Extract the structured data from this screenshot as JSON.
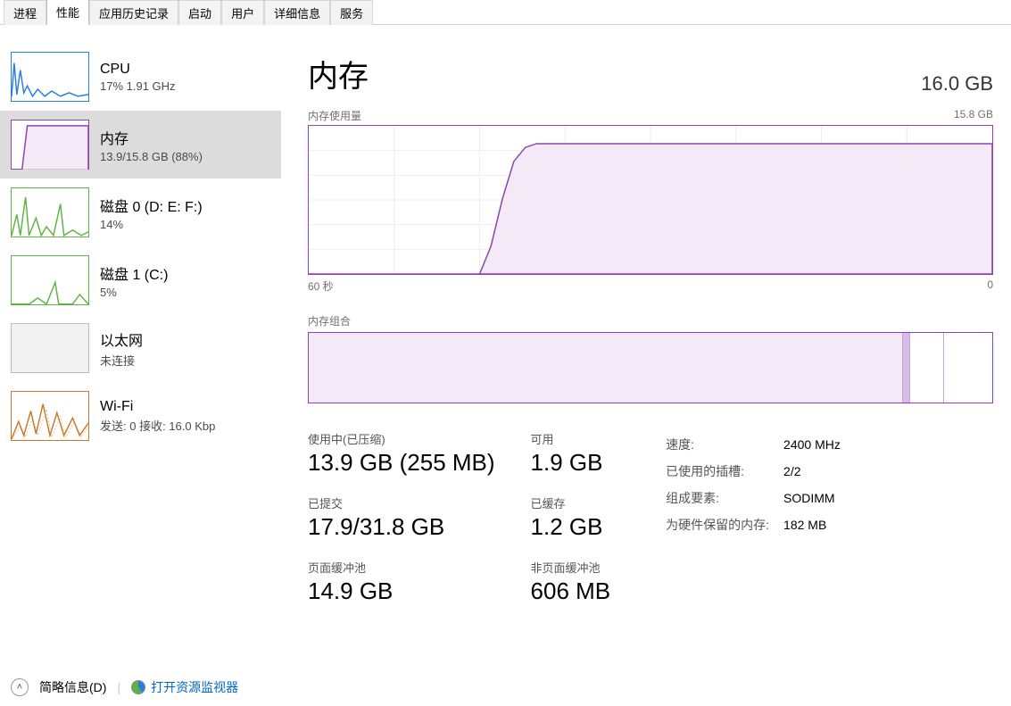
{
  "tabs": [
    "进程",
    "性能",
    "应用历史记录",
    "启动",
    "用户",
    "详细信息",
    "服务"
  ],
  "active_tab_index": 1,
  "sidebar": [
    {
      "title": "CPU",
      "sub": "17% 1.91 GHz",
      "color": "#2a7de1",
      "kind": "cpu"
    },
    {
      "title": "内存",
      "sub": "13.9/15.8 GB (88%)",
      "color": "#8e44ad",
      "kind": "memory",
      "selected": true
    },
    {
      "title": "磁盘 0 (D: E: F:)",
      "sub": "14%",
      "color": "#5fb343",
      "kind": "disk"
    },
    {
      "title": "磁盘 1 (C:)",
      "sub": "5%",
      "color": "#5fb343",
      "kind": "disk"
    },
    {
      "title": "以太网",
      "sub": "未连接",
      "color": "#bcbcbc",
      "kind": "net-off"
    },
    {
      "title": "Wi-Fi",
      "sub": "发送: 0 接收: 16.0 Kbp",
      "color": "#c77a2e",
      "kind": "wifi"
    }
  ],
  "header": {
    "title": "内存",
    "total": "16.0 GB"
  },
  "chart": {
    "label_left": "内存使用量",
    "label_right": "15.8 GB",
    "x_left": "60 秒",
    "x_right": "0"
  },
  "chart_data": {
    "type": "area",
    "title": "内存使用量",
    "xlabel": "60 秒 → 0",
    "ylabel": "GB",
    "ylim": [
      0,
      15.8
    ],
    "x_seconds_ago": [
      60,
      55,
      50,
      45,
      44,
      43,
      42,
      41,
      40,
      35,
      30,
      25,
      20,
      15,
      10,
      5,
      0
    ],
    "values_gb": [
      0,
      0,
      0,
      0,
      3,
      8,
      12,
      13.5,
      13.9,
      13.9,
      13.9,
      13.9,
      13.9,
      13.9,
      13.9,
      13.9,
      13.9
    ]
  },
  "composition": {
    "label": "内存组合",
    "segments_percent": {
      "in_use": 87,
      "modified": 1,
      "standby": 5,
      "free": 7
    }
  },
  "stats": {
    "in_use_label": "使用中(已压缩)",
    "in_use_value": "13.9 GB (255 MB)",
    "available_label": "可用",
    "available_value": "1.9 GB",
    "committed_label": "已提交",
    "committed_value": "17.9/31.8 GB",
    "cached_label": "已缓存",
    "cached_value": "1.2 GB",
    "paged_label": "页面缓冲池",
    "paged_value": "14.9 GB",
    "nonpaged_label": "非页面缓冲池",
    "nonpaged_value": "606 MB"
  },
  "specs": {
    "speed_label": "速度:",
    "speed_value": "2400 MHz",
    "slots_label": "已使用的插槽:",
    "slots_value": "2/2",
    "form_label": "组成要素:",
    "form_value": "SODIMM",
    "reserved_label": "为硬件保留的内存:",
    "reserved_value": "182 MB"
  },
  "footer": {
    "fewer_details": "简略信息(D)",
    "open_resmon": "打开资源监视器"
  }
}
